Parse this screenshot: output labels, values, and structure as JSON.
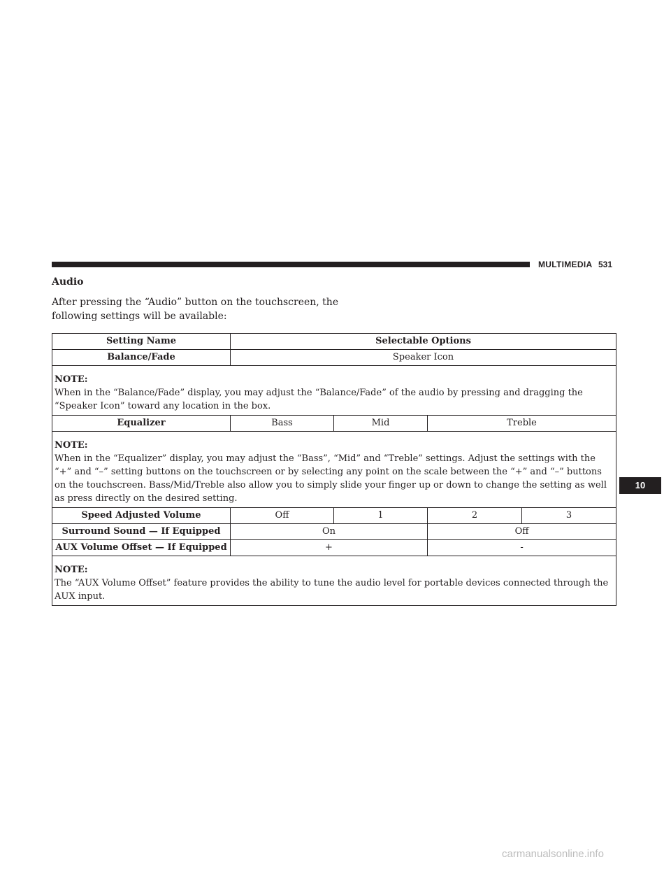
{
  "header": {
    "section": "MULTIMEDIA",
    "page_number": "531"
  },
  "section_title": "Audio",
  "intro_text": "After pressing the “Audio” button on the touchscreen, the following settings will be available:",
  "table": {
    "headers": {
      "setting_name": "Setting Name",
      "selectable_options": "Selectable Options"
    },
    "balance_fade": {
      "name": "Balance/Fade",
      "option": "Speaker Icon",
      "note_label": "NOTE:",
      "note_text": "When in the “Balance/Fade” display, you may adjust the “Balance/Fade” of the audio by pressing and dragging the “Speaker Icon” toward any location in the box."
    },
    "equalizer": {
      "name": "Equalizer",
      "options": [
        "Bass",
        "Mid",
        "Treble"
      ],
      "note_label": "NOTE:",
      "note_text": "When in the “Equalizer” display, you may adjust the “Bass”, “Mid” and “Treble” settings. Adjust the settings with the “+” and “–” setting buttons on the touchscreen or by selecting any point on the scale between the “+” and “–” buttons on the touchscreen. Bass/Mid/Treble also allow you to simply slide your finger up or down to change the setting as well as press directly on the desired setting."
    },
    "speed_adjusted_volume": {
      "name": "Speed Adjusted Volume",
      "options": [
        "Off",
        "1",
        "2",
        "3"
      ]
    },
    "surround_sound": {
      "name": "Surround Sound — If Equipped",
      "options": [
        "On",
        "Off"
      ]
    },
    "aux_volume_offset": {
      "name": "AUX Volume Offset — If Equipped",
      "options": [
        "+",
        "-"
      ],
      "note_label": "NOTE:",
      "note_text": "The “AUX Volume Offset” feature provides the ability to tune the audio level for portable devices connected through the AUX input."
    }
  },
  "chapter_tab": "10",
  "watermark": "carmanualsonline.info"
}
